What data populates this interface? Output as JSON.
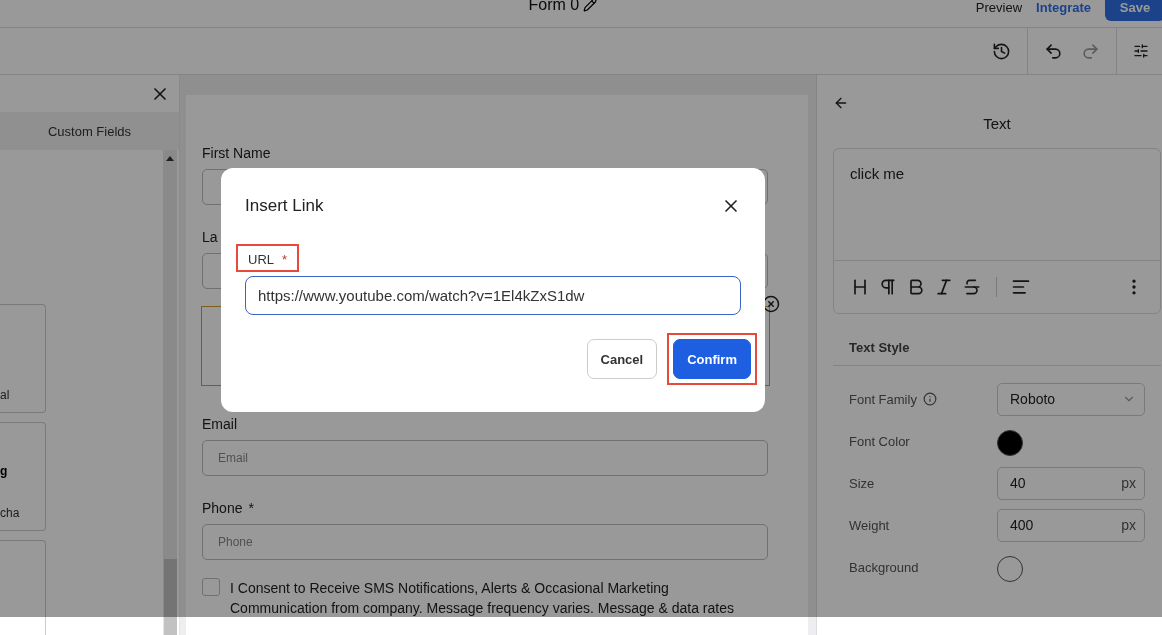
{
  "header": {
    "title": "Form 0",
    "actions": [
      {
        "label": "Preview",
        "kind": "plain"
      },
      {
        "label": "Integrate",
        "kind": "link"
      },
      {
        "label": "Save",
        "kind": "primary"
      }
    ]
  },
  "toolbar": {
    "redo": {
      "disabled": true
    }
  },
  "left_panel": {
    "tab": "Custom Fields",
    "cards": [
      {
        "kind": "text",
        "lines": [
          {
            "text": "al",
            "bold": false
          }
        ]
      },
      {
        "kind": "text",
        "lines": [
          {
            "text": "g",
            "bold": true
          },
          {
            "text": "cha",
            "bold": false
          }
        ]
      },
      {
        "kind": "blank"
      }
    ]
  },
  "form": {
    "items": [
      {
        "kind": "field",
        "label": "First Name"
      },
      {
        "kind": "field",
        "label": "La"
      },
      {
        "kind": "text_block",
        "selected": true
      },
      {
        "kind": "field",
        "label": "Email",
        "placeholder": "Email"
      },
      {
        "kind": "field",
        "label": "Phone",
        "required_mark": "*",
        "placeholder": "Phone"
      },
      {
        "kind": "checkbox",
        "checked": false,
        "lines": [
          "I Consent to Receive SMS Notifications, Alerts & Occasional Marketing",
          "Communication from company. Message frequency varies. Message & data rates"
        ]
      }
    ]
  },
  "modal": {
    "title": "Insert Link",
    "url_label": "URL",
    "required_mark": "*",
    "url_highlighted": true,
    "url_value": "https://www.youtube.com/watch?v=1El4kZxS1dw",
    "buttons": [
      {
        "label": "Cancel",
        "kind": "secondary",
        "highlighted": false
      },
      {
        "label": "Confirm",
        "kind": "primary",
        "highlighted": true
      }
    ]
  },
  "right_panel": {
    "title": "Text",
    "editor_text": "click me",
    "section": "Text Style",
    "rows": [
      {
        "kind": "select",
        "label": "Font Family",
        "info": true,
        "value": "Roboto"
      },
      {
        "kind": "color",
        "label": "Font Color",
        "color": "#000000"
      },
      {
        "kind": "number",
        "label": "Size",
        "value": "40",
        "unit": "px"
      },
      {
        "kind": "number",
        "label": "Weight",
        "value": "400",
        "unit": "px"
      },
      {
        "kind": "color",
        "label": "Background",
        "color": "#999999"
      }
    ]
  }
}
